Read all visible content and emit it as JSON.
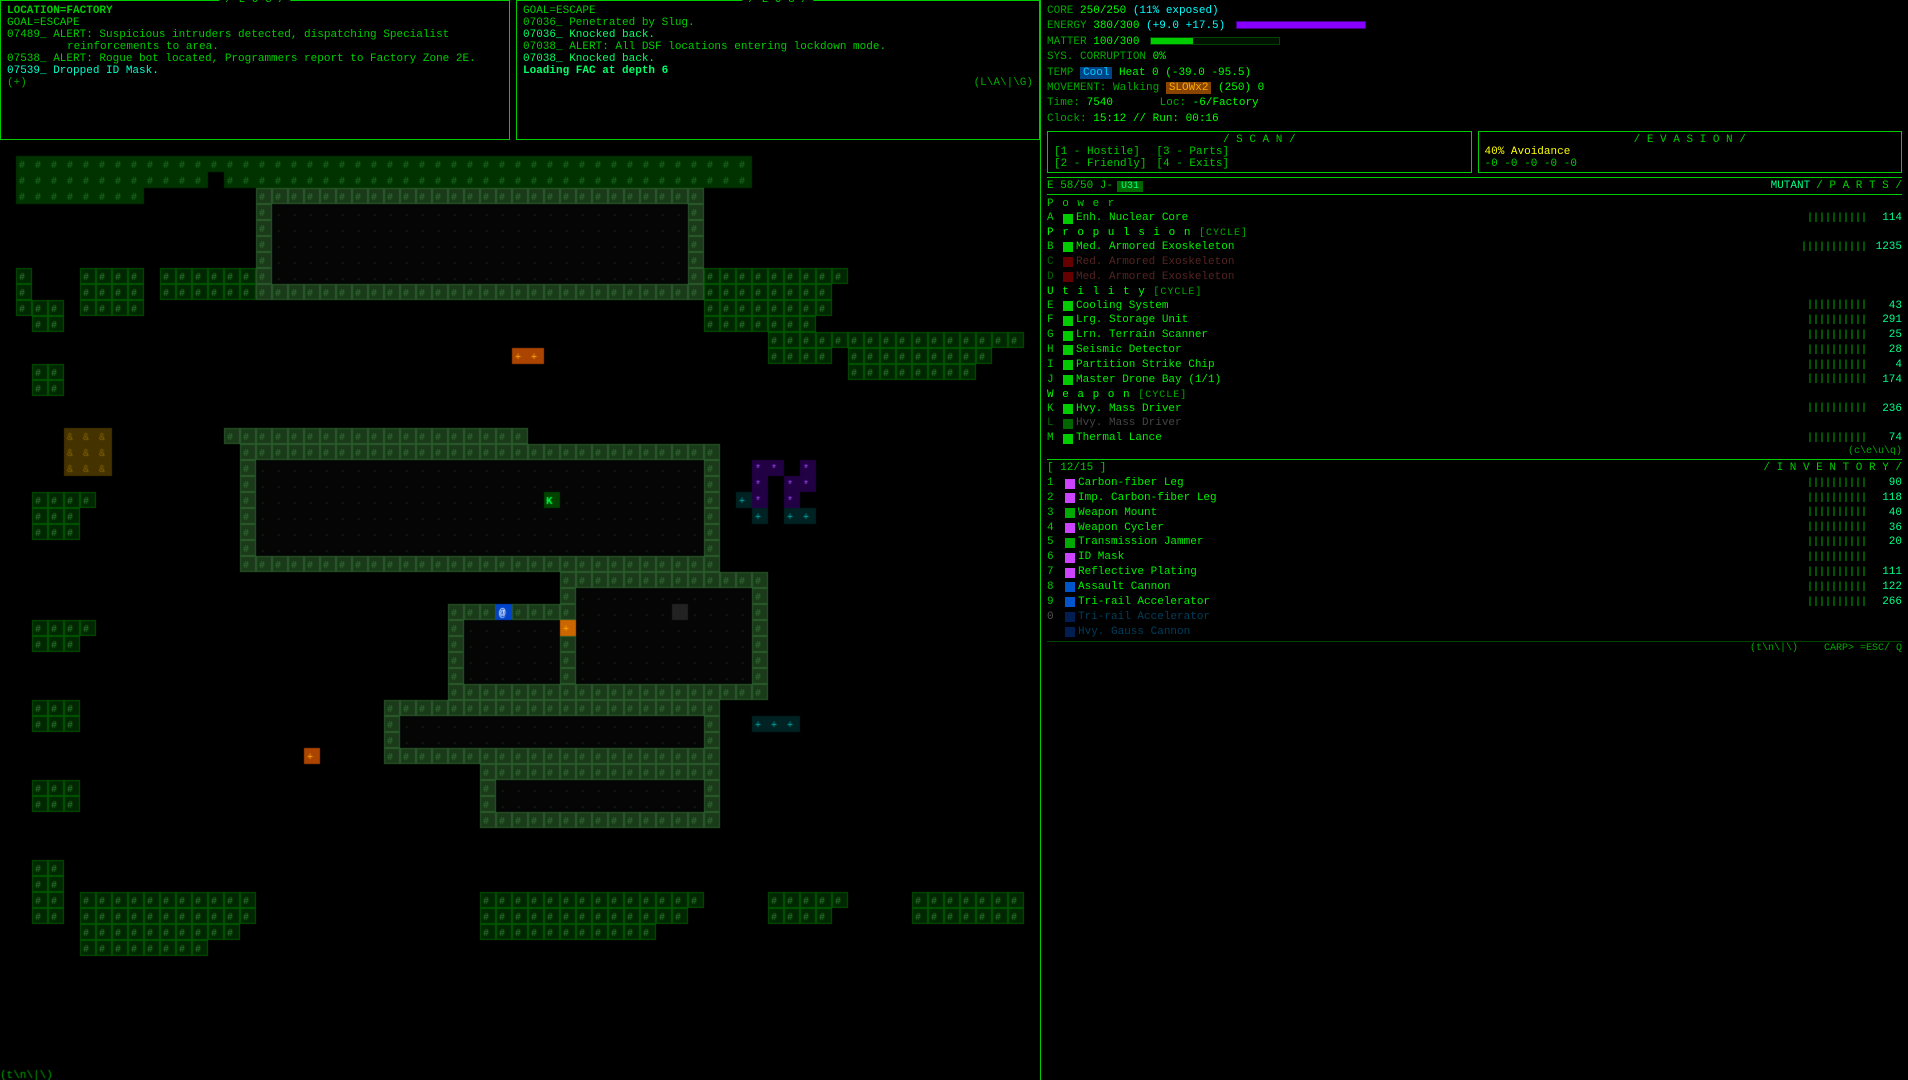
{
  "ui": {
    "log_title": "/ L O G /",
    "left_log": {
      "title": "/ L O G /",
      "lines": [
        {
          "text": "LOCATION=FACTORY",
          "class": "log-loc"
        },
        {
          "text": "GOAL=ESCAPE",
          "class": "log-goal"
        },
        {
          "text": "07489_ ALERT: Suspicious intruders detected, dispatching Specialist",
          "class": "log-normal"
        },
        {
          "text": "           reinforcements to area.",
          "class": "log-normal"
        },
        {
          "text": "07538_ ALERT: Rogue bot located, Programmers report to Factory Zone 2E.",
          "class": "log-normal"
        },
        {
          "text": "07539_ Dropped ID Mask.",
          "class": "log-dropped"
        },
        {
          "text": "(+)",
          "class": "log-normal"
        }
      ]
    },
    "right_log": {
      "title": "/ L O G /",
      "lines": [
        {
          "text": "GOAL=ESCAPE",
          "class": "log-goal"
        },
        {
          "text": "07036_ Penetrated by Slug.",
          "class": "log-normal"
        },
        {
          "text": "07036_ Knocked back.",
          "class": "log-highlight"
        },
        {
          "text": "07038_ ALERT: All DSF locations entering lockdown mode.",
          "class": "log-normal"
        },
        {
          "text": "07038_ Knocked back.",
          "class": "log-highlight"
        },
        {
          "text": "Loading FAC at depth 6",
          "class": "log-loading"
        },
        {
          "text": "(L\\A\\|\\G)",
          "class": "log-normal"
        }
      ]
    },
    "stats": {
      "core_label": "CORE",
      "core_val": "250/250",
      "core_exposed": "(11% exposed)",
      "energy_label": "ENERGY",
      "energy_val": "380/300",
      "energy_bonus": "(+9.0 +17.5)",
      "matter_label": "MATTER",
      "matter_val": "100/300",
      "sys_label": "SYS. CORRUPTION",
      "sys_val": "0%",
      "temp_label": "TEMP",
      "cool_tag": "Cool",
      "heat_val": "Heat 0 (-39.0 -95.5)",
      "movement_label": "MOVEMENT: Walking",
      "slow_tag": "SLOWx2",
      "movement_val": "(250) 0",
      "time_label": "Time:",
      "time_val": "7540",
      "loc_label": "Loc:",
      "loc_val": "-6/Factory",
      "clock_label": "Clock:",
      "clock_val": "15:12 // Run: 00:16"
    },
    "scan": {
      "title": "/ S C A N /",
      "items": [
        {
          "key": "[1 - Hostile]",
          "val": "[3 - Parts]"
        },
        {
          "key": "[2 - Friendly]",
          "val": "[4 - Exits]"
        }
      ]
    },
    "evasion": {
      "title": "/ E V A S I O N /",
      "avoidance_pct": "40% Avoidance",
      "vals": "-0 -0 -0 -0 -0"
    },
    "parts_header": {
      "left": "E 58/50 J-",
      "u31_tag": "U31",
      "right": "MUTANT",
      "parts_label": "/ P A R T S /"
    },
    "parts": {
      "power_label": "P o w e r",
      "power_items": [
        {
          "key": "A",
          "icon": "green",
          "name": "Enh. Nuclear Core",
          "bars": "||||||||||",
          "val": "114"
        }
      ],
      "propulsion_label": "P r o p u l s i o n",
      "propulsion_tag": "[CYCLE]",
      "propulsion_items": [
        {
          "key": "B",
          "icon": "green",
          "name": "Med. Armored Exoskeleton",
          "bars": "|||||||||||",
          "val": "1235"
        },
        {
          "key": "C",
          "icon": "red",
          "name": "Red. Armored Exoskeleton",
          "bars": "",
          "val": ""
        },
        {
          "key": "D",
          "icon": "red",
          "name": "Med. Armored Exoskeleton",
          "bars": "",
          "val": ""
        }
      ],
      "utility_label": "U t i l i t y",
      "utility_tag": "[CYCLE]",
      "utility_items": [
        {
          "key": "E",
          "icon": "green",
          "name": "Cooling System",
          "bars": "||||||||||",
          "val": "43"
        },
        {
          "key": "F",
          "icon": "green",
          "name": "Lrg. Storage Unit",
          "bars": "||||||||||",
          "val": "291"
        },
        {
          "key": "G",
          "icon": "green",
          "name": "Lrn. Terrain Scanner",
          "bars": "||||||||||",
          "val": "25"
        },
        {
          "key": "H",
          "icon": "green",
          "name": "Seismic Detector",
          "bars": "||||||||||",
          "val": "28"
        },
        {
          "key": "I",
          "icon": "green",
          "name": "Partition Strike Chip",
          "bars": "||||||||||",
          "val": "4"
        },
        {
          "key": "J",
          "icon": "green",
          "name": "Master Drone Bay (1/1)",
          "bars": "||||||||||",
          "val": "174"
        }
      ],
      "weapon_label": "W e a p o n",
      "weapon_tag": "[CYCLE]",
      "weapon_items": [
        {
          "key": "K",
          "icon": "green",
          "name": "Hvy. Mass Driver",
          "bars": "||||||||||",
          "val": "236"
        },
        {
          "key": "L",
          "icon": "green",
          "name": "Hvy. Mass Driver",
          "bars": "",
          "val": ""
        },
        {
          "key": "M",
          "icon": "green",
          "name": "Thermal Lance",
          "bars": "||||||||||",
          "val": "74"
        }
      ]
    },
    "inventory": {
      "header_left": "[ 12/15 ]",
      "header_right": "/ I N V E N T O R Y /",
      "items": [
        {
          "num": "1",
          "icon": "purple",
          "name": "Carbon-fiber Leg",
          "bars": "||||||||||",
          "val": "90"
        },
        {
          "num": "2",
          "icon": "purple",
          "name": "Imp. Carbon-fiber Leg",
          "bars": "||||||||||",
          "val": "118"
        },
        {
          "num": "3",
          "icon": "green",
          "name": "Weapon Mount",
          "bars": "||||||||||",
          "val": "40"
        },
        {
          "num": "4",
          "icon": "purple",
          "name": "Weapon Cycler",
          "bars": "||||||||||",
          "val": "36"
        },
        {
          "num": "5",
          "icon": "green",
          "name": "Transmission Jammer",
          "bars": "||||||||||",
          "val": "20"
        },
        {
          "num": "6",
          "icon": "purple",
          "name": "ID Mask",
          "bars": "||||||||||",
          "val": ""
        },
        {
          "num": "7",
          "icon": "purple",
          "name": "Reflective Plating",
          "bars": "||||||||||",
          "val": "111"
        },
        {
          "num": "8",
          "icon": "blue",
          "name": "Assault Cannon",
          "bars": "||||||||||",
          "val": "122"
        },
        {
          "num": "9",
          "icon": "blue",
          "name": "Tri-rail Accelerator",
          "bars": "||||||||||",
          "val": "266"
        },
        {
          "num": "0",
          "icon": "blue",
          "name": "Tri-rail Accelerator",
          "bars": "",
          "val": "",
          "dimmed": true
        },
        {
          "num": "",
          "icon": "blue",
          "name": "Hvy. Gauss Cannon",
          "bars": "",
          "val": "",
          "dimmed": true
        }
      ]
    },
    "bottom_nav": "(c\\e\\u\\q)",
    "map_bottom_nav": "(t\\n\\|\\)",
    "arrow_nav": "CARP> =ESC/ Q"
  }
}
